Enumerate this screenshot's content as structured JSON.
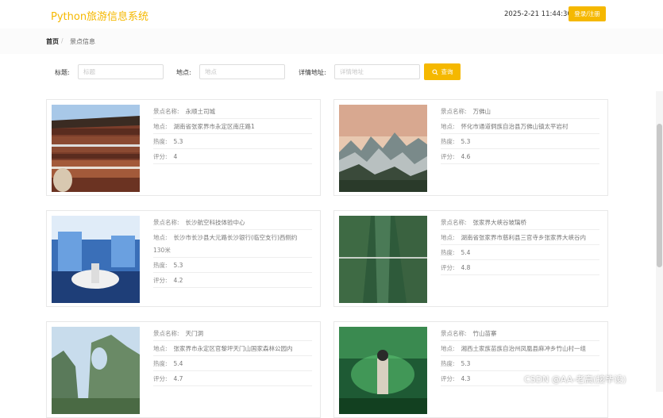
{
  "header": {
    "title": "Python旅游信息系统",
    "datetime": "2025-2-21 11:44:30",
    "login_label": "登录/注册"
  },
  "breadcrumb": {
    "home": "首页",
    "separator": "/",
    "current": "景点信息"
  },
  "search": {
    "title_label": "标题:",
    "title_placeholder": "标题",
    "location_label": "地点:",
    "location_placeholder": "地点",
    "address_label": "详情地址:",
    "address_placeholder": "详情地址",
    "button_label": "查询",
    "button_icon": "search-icon"
  },
  "field_labels": {
    "name": "景点名称:",
    "location": "地点:",
    "heat": "热度:",
    "rating": "评分:"
  },
  "spots": [
    {
      "name": "永顺土司城",
      "location": "湖南省张家界市永定区南庄路1",
      "heat": "5.3",
      "rating": "4"
    },
    {
      "name": "万佛山",
      "location": "怀化市通道侗族自治县万佛山镇太平岩村",
      "heat": "5.3",
      "rating": "4.6"
    },
    {
      "name": "长沙航空科技体验中心",
      "location": "长沙市长沙县大元路长沙银行(临空支行)西侧约",
      "location_cont": "130米",
      "heat": "5.3",
      "rating": "4.2"
    },
    {
      "name": "张家界大峡谷玻璃桥",
      "location": "湖南省张家界市慈利县三官寺乡张家界大峡谷内",
      "heat": "5.4",
      "rating": "4.8"
    },
    {
      "name": "天门洞",
      "location": "张家界市永定区官黎坪天门山国家森林公园内",
      "heat": "5.4",
      "rating": "4.7"
    },
    {
      "name": "竹山苗寨",
      "location": "湘西土家族苗族自治州凤凰县麻冲乡竹山村一组",
      "heat": "5.3",
      "rating": "4.3"
    }
  ],
  "watermark": "CSDN @AA-老高(接毕设)",
  "colors": {
    "accent": "#f5b800"
  }
}
